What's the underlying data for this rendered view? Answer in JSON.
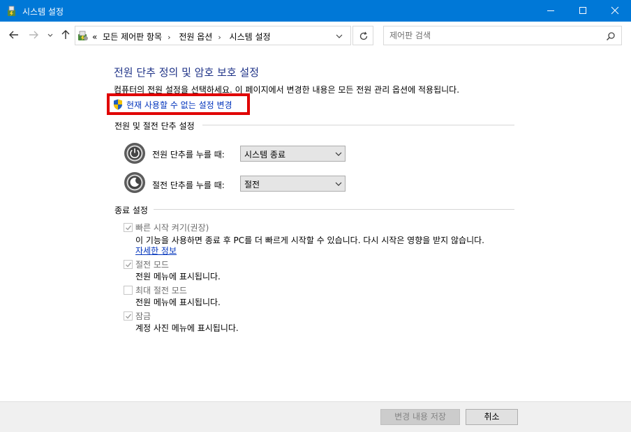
{
  "window": {
    "title": "시스템 설정"
  },
  "address_bar": {
    "prefix": "«",
    "crumbs": [
      "모든 제어판 항목",
      "전원 옵션",
      "시스템 설정"
    ],
    "separator": "›"
  },
  "search": {
    "placeholder": "제어판 검색"
  },
  "main": {
    "title": "전원 단추 정의 및 암호 보호 설정",
    "instruction": "컴퓨터의 전원 설정을 선택하세요. 이 페이지에서 변경한 내용은 모든 전원 관리 옵션에 적용됩니다.",
    "change_link": "현재 사용할 수 없는 설정 변경"
  },
  "power_section": {
    "header": "전원 및 절전 단추 설정",
    "power_button_label": "전원 단추를 누를 때:",
    "power_button_value": "시스템 종료",
    "sleep_button_label": "절전 단추를 누를 때:",
    "sleep_button_value": "절전"
  },
  "shutdown_section": {
    "header": "종료 설정",
    "items": [
      {
        "label": "빠른 시작 켜기(권장)",
        "checked": true,
        "desc": "이 기능을 사용하면 종료 후 PC를 더 빠르게 시작할 수 있습니다. 다시 시작은 영향을 받지 않습니다.",
        "link": "자세한 정보"
      },
      {
        "label": "절전 모드",
        "checked": true,
        "desc": "전원 메뉴에 표시됩니다."
      },
      {
        "label": "최대 절전 모드",
        "checked": false,
        "desc": "전원 메뉴에 표시됩니다."
      },
      {
        "label": "잠금",
        "checked": true,
        "desc": "계정 사진 메뉴에 표시됩니다."
      }
    ]
  },
  "footer": {
    "save_label": "변경 내용 저장",
    "cancel_label": "취소"
  },
  "colors": {
    "titlebar": "#0078d7",
    "heading": "#1e3287",
    "link": "#0033bc",
    "highlight": "#e00000"
  }
}
